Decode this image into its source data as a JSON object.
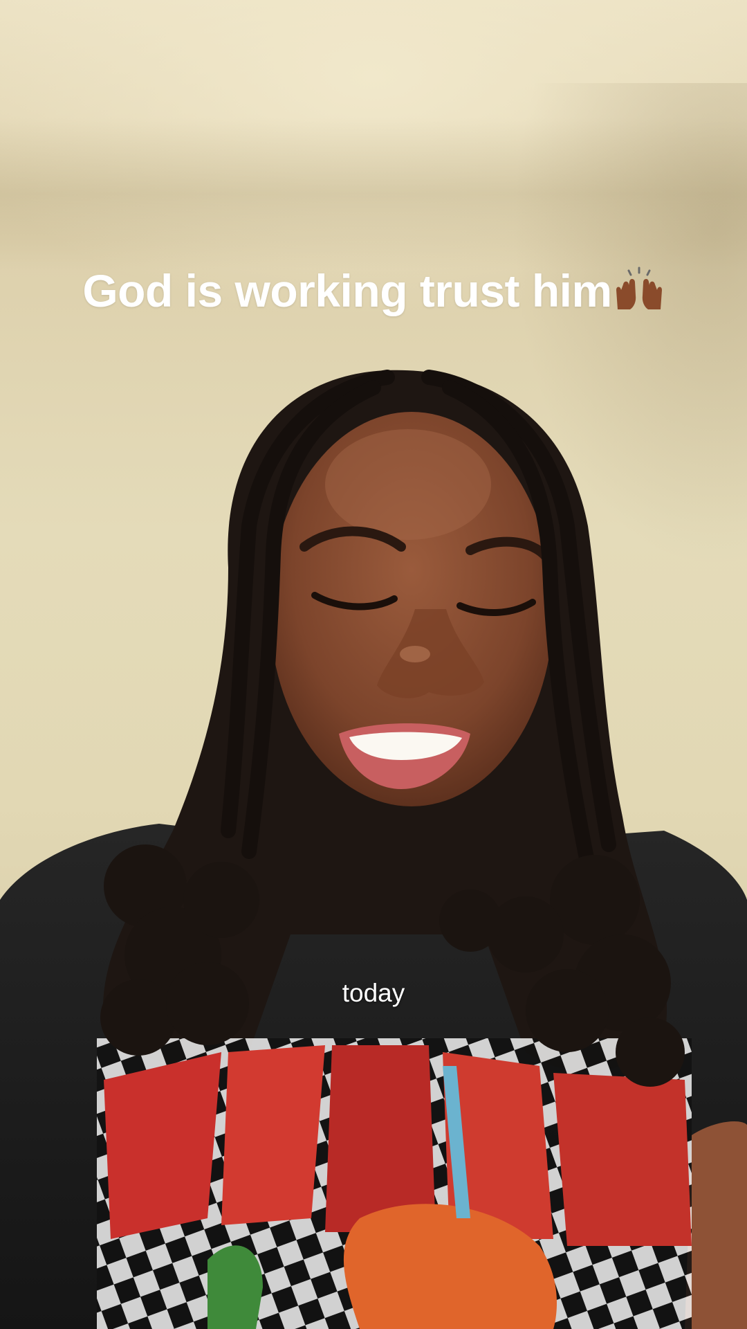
{
  "overlay": {
    "caption_text": "God is working trust him",
    "caption_emoji_icon": "raising-hands-emoji",
    "subtitle": "today"
  },
  "colors": {
    "wall": "#e4dbb9",
    "caption_text": "#ffffff",
    "shirt": "#1d1d1d",
    "skin": "#8a4e33",
    "hair": "#1e1612"
  }
}
